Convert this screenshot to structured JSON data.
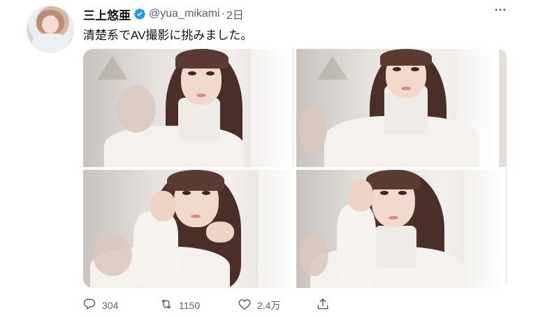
{
  "tweet": {
    "author_name": "三上悠亜",
    "handle": "@yua_mikami",
    "separator": "·",
    "time": "2日",
    "text": "清楚系でAV撮影に挑みました。"
  },
  "icons": {
    "verified": "verified-badge-icon",
    "more": "more-options-icon",
    "reply": "reply-icon",
    "retweet": "retweet-icon",
    "like": "like-icon",
    "share": "share-icon"
  },
  "actions": {
    "reply_count": "304",
    "retweet_count": "1150",
    "like_count": "2.4万"
  },
  "colors": {
    "verified": "#1d9bf0",
    "secondary_text": "#536471",
    "primary_text": "#0f1419"
  },
  "media": {
    "photo_count": 4
  }
}
